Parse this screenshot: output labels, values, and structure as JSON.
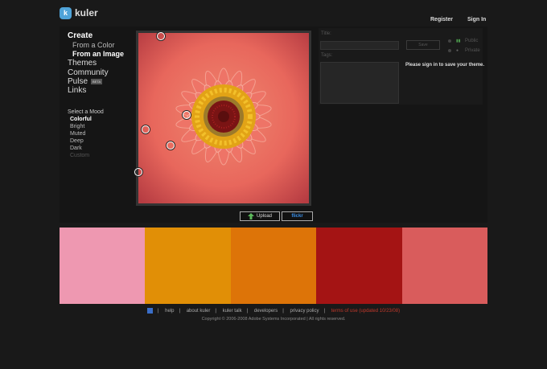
{
  "app": {
    "name": "kuler",
    "logo_glyph": "k"
  },
  "header": {
    "register": "Register",
    "signin": "Sign In"
  },
  "nav": {
    "create": "Create",
    "from_color": "From a Color",
    "from_image": "From an Image",
    "themes": "Themes",
    "community": "Community",
    "pulse": "Pulse",
    "pulse_badge": "BETA",
    "links": "Links"
  },
  "mood": {
    "title": "Select a Mood",
    "options": [
      "Colorful",
      "Bright",
      "Muted",
      "Deep",
      "Dark",
      "Custom"
    ],
    "selected": "Colorful"
  },
  "image_tools": {
    "upload": "Upload",
    "flickr": "flickr"
  },
  "theme_form": {
    "title_label": "Title:",
    "tags_label": "Tags:",
    "save_label": "Save",
    "public_label": "Public",
    "private_label": "Private",
    "signin_message": "Please sign in to save your theme."
  },
  "swatches": [
    "#ee98b1",
    "#e18f06",
    "#dd7408",
    "#a41414",
    "#d95c5c"
  ],
  "footer": {
    "links": [
      "help",
      "about kuler",
      "kuler talk",
      "developers",
      "privacy policy"
    ],
    "terms": "terms of use (updated 10/23/08)",
    "copyright": "Copyright © 2006-2008 Adobe Systems Incorporated | All rights reserved."
  },
  "colors": {
    "background": "#191919",
    "terms_red": "#c0392b",
    "logo_blue": "#4fa3d8"
  }
}
